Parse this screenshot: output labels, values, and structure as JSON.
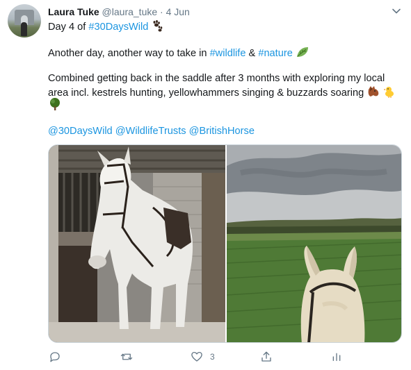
{
  "tweet": {
    "author_name": "Laura Tuke",
    "author_handle": "@laura_tuke",
    "separator": "·",
    "date": "4 Jun",
    "line1_prefix": "Day 4 of ",
    "line1_hashtag": "#30DaysWild",
    "line2_prefix": "Another day, another way to take in ",
    "line2_tag1": "#wildlife",
    "line2_amp": " & ",
    "line2_tag2": "#nature",
    "line3": "Combined getting back in the saddle after 3 months with exploring my local",
    "line4": "area incl. kestrels hunting, yellowhammers singing & buzzards soaring",
    "mention1": "@30DaysWild",
    "mention2": "@WildlifeTrusts",
    "mention3": "@BritishHorse"
  },
  "actions": {
    "reply_icon": "reply-icon",
    "retweet_icon": "retweet-icon",
    "like_icon": "heart-icon",
    "like_count": "3",
    "share_icon": "share-icon",
    "analytics_icon": "analytics-icon"
  },
  "colors": {
    "link": "#1b95e0",
    "text": "#14171a",
    "muted": "#657786",
    "border": "#ccd6dd"
  }
}
